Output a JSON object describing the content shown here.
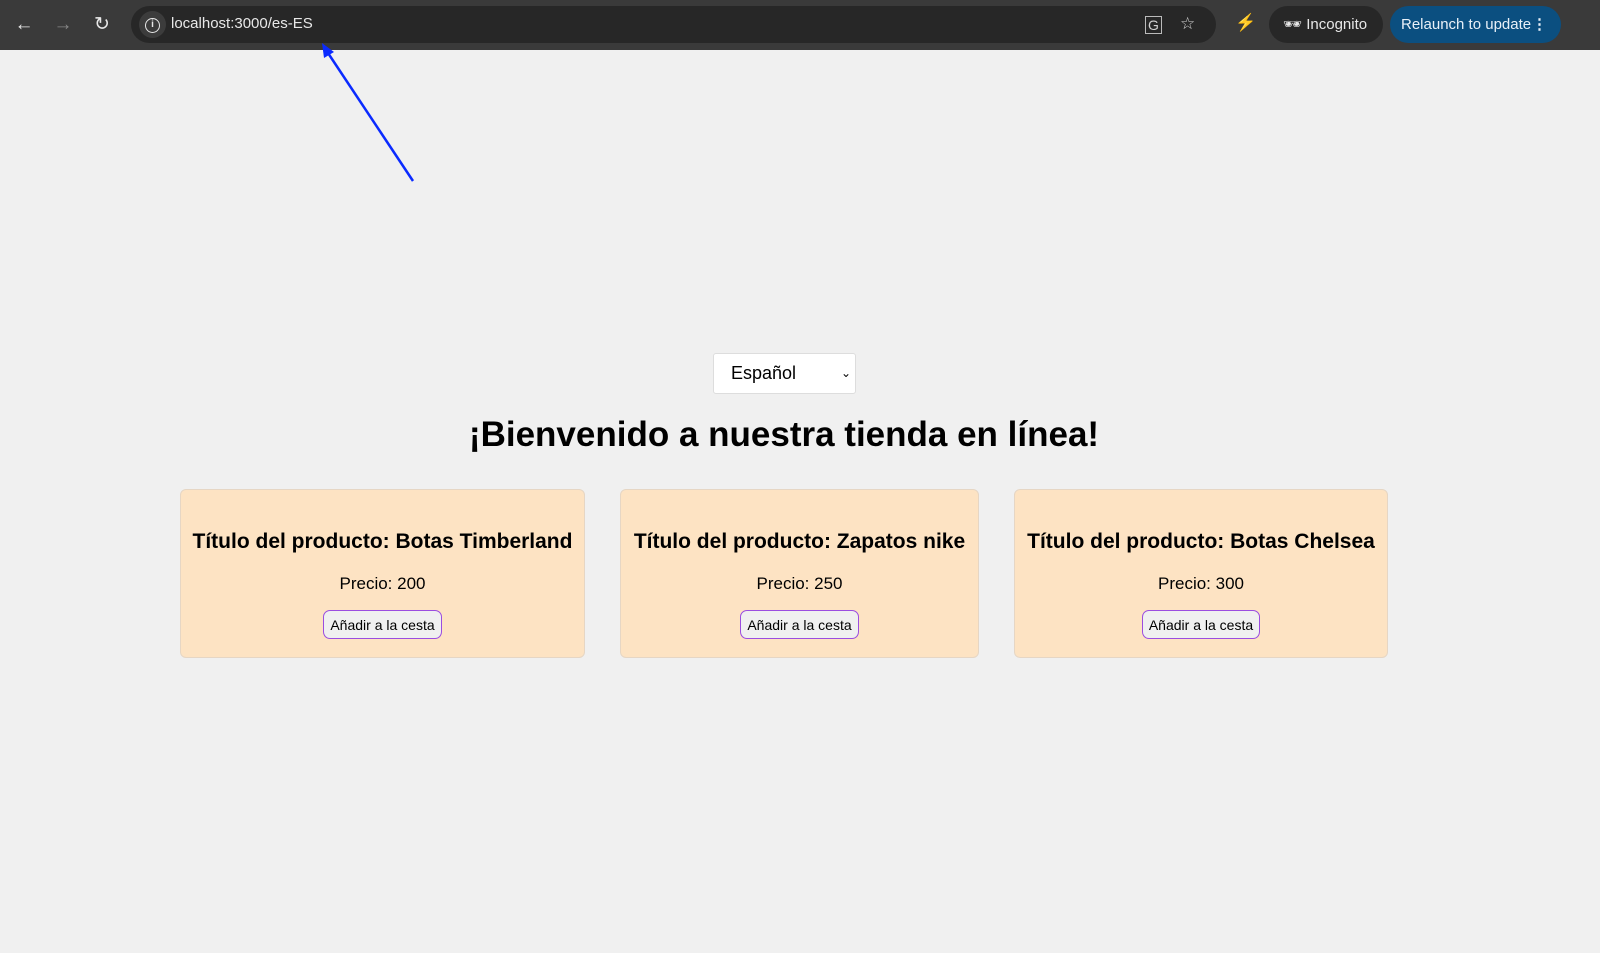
{
  "browser": {
    "url": "localhost:3000/es-ES",
    "incognito_label": "Incognito",
    "relaunch_label": "Relaunch to update"
  },
  "page": {
    "language_select": {
      "selected": "Español"
    },
    "heading": "¡Bienvenido a nuestra tienda en línea!",
    "products": [
      {
        "title": "Título del producto: Botas Timberland",
        "price": "Precio: 200",
        "button": "Añadir a la cesta"
      },
      {
        "title": "Título del producto: Zapatos nike",
        "price": "Precio: 250",
        "button": "Añadir a la cesta"
      },
      {
        "title": "Título del producto: Botas Chelsea",
        "price": "Precio: 300",
        "button": "Añadir a la cesta"
      }
    ],
    "card_color": "#fde3c3",
    "annotation_arrow_color": "#0a2aff"
  }
}
